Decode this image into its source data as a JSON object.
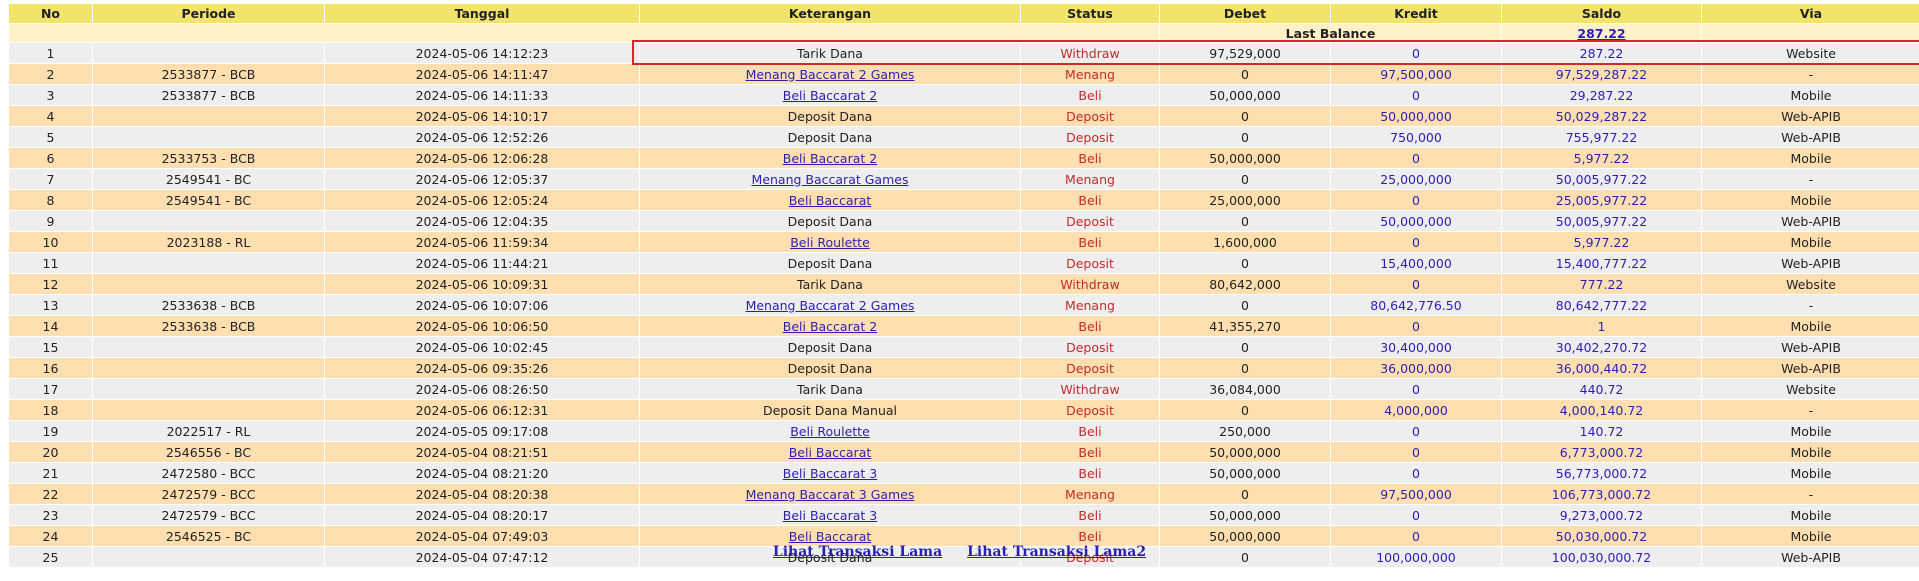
{
  "columns": [
    "No",
    "Periode",
    "Tanggal",
    "Keterangan",
    "Status",
    "Debet",
    "Kredit",
    "Saldo",
    "Via"
  ],
  "last_balance": {
    "label": "Last Balance",
    "value": "287.22"
  },
  "rows": [
    {
      "no": "1",
      "periode": "",
      "tanggal": "2024-05-06 14:12:23",
      "keterangan": "Tarik Dana",
      "link": false,
      "status": "Withdraw",
      "debet": "97,529,000",
      "kredit": "0",
      "saldo": "287.22",
      "via": "Website"
    },
    {
      "no": "2",
      "periode": "2533877 - BCB",
      "tanggal": "2024-05-06 14:11:47",
      "keterangan": "Menang Baccarat 2 Games",
      "link": true,
      "status": "Menang",
      "debet": "0",
      "kredit": "97,500,000",
      "saldo": "97,529,287.22",
      "via": "-"
    },
    {
      "no": "3",
      "periode": "2533877 - BCB",
      "tanggal": "2024-05-06 14:11:33",
      "keterangan": "Beli Baccarat 2",
      "link": true,
      "status": "Beli",
      "debet": "50,000,000",
      "kredit": "0",
      "saldo": "29,287.22",
      "via": "Mobile"
    },
    {
      "no": "4",
      "periode": "",
      "tanggal": "2024-05-06 14:10:17",
      "keterangan": "Deposit Dana",
      "link": false,
      "status": "Deposit",
      "debet": "0",
      "kredit": "50,000,000",
      "saldo": "50,029,287.22",
      "via": "Web-APIB"
    },
    {
      "no": "5",
      "periode": "",
      "tanggal": "2024-05-06 12:52:26",
      "keterangan": "Deposit Dana",
      "link": false,
      "status": "Deposit",
      "debet": "0",
      "kredit": "750,000",
      "saldo": "755,977.22",
      "via": "Web-APIB"
    },
    {
      "no": "6",
      "periode": "2533753 - BCB",
      "tanggal": "2024-05-06 12:06:28",
      "keterangan": "Beli Baccarat 2",
      "link": true,
      "status": "Beli",
      "debet": "50,000,000",
      "kredit": "0",
      "saldo": "5,977.22",
      "via": "Mobile"
    },
    {
      "no": "7",
      "periode": "2549541 - BC",
      "tanggal": "2024-05-06 12:05:37",
      "keterangan": "Menang Baccarat Games",
      "link": true,
      "status": "Menang",
      "debet": "0",
      "kredit": "25,000,000",
      "saldo": "50,005,977.22",
      "via": "-"
    },
    {
      "no": "8",
      "periode": "2549541 - BC",
      "tanggal": "2024-05-06 12:05:24",
      "keterangan": "Beli Baccarat",
      "link": true,
      "status": "Beli",
      "debet": "25,000,000",
      "kredit": "0",
      "saldo": "25,005,977.22",
      "via": "Mobile"
    },
    {
      "no": "9",
      "periode": "",
      "tanggal": "2024-05-06 12:04:35",
      "keterangan": "Deposit Dana",
      "link": false,
      "status": "Deposit",
      "debet": "0",
      "kredit": "50,000,000",
      "saldo": "50,005,977.22",
      "via": "Web-APIB"
    },
    {
      "no": "10",
      "periode": "2023188 - RL",
      "tanggal": "2024-05-06 11:59:34",
      "keterangan": "Beli Roulette",
      "link": true,
      "status": "Beli",
      "debet": "1,600,000",
      "kredit": "0",
      "saldo": "5,977.22",
      "via": "Mobile"
    },
    {
      "no": "11",
      "periode": "",
      "tanggal": "2024-05-06 11:44:21",
      "keterangan": "Deposit Dana",
      "link": false,
      "status": "Deposit",
      "debet": "0",
      "kredit": "15,400,000",
      "saldo": "15,400,777.22",
      "via": "Web-APIB"
    },
    {
      "no": "12",
      "periode": "",
      "tanggal": "2024-05-06 10:09:31",
      "keterangan": "Tarik Dana",
      "link": false,
      "status": "Withdraw",
      "debet": "80,642,000",
      "kredit": "0",
      "saldo": "777.22",
      "via": "Website"
    },
    {
      "no": "13",
      "periode": "2533638 - BCB",
      "tanggal": "2024-05-06 10:07:06",
      "keterangan": "Menang Baccarat 2 Games",
      "link": true,
      "status": "Menang",
      "debet": "0",
      "kredit": "80,642,776.50",
      "saldo": "80,642,777.22",
      "via": "-"
    },
    {
      "no": "14",
      "periode": "2533638 - BCB",
      "tanggal": "2024-05-06 10:06:50",
      "keterangan": "Beli Baccarat 2",
      "link": true,
      "status": "Beli",
      "debet": "41,355,270",
      "kredit": "0",
      "saldo": "1",
      "via": "Mobile"
    },
    {
      "no": "15",
      "periode": "",
      "tanggal": "2024-05-06 10:02:45",
      "keterangan": "Deposit Dana",
      "link": false,
      "status": "Deposit",
      "debet": "0",
      "kredit": "30,400,000",
      "saldo": "30,402,270.72",
      "via": "Web-APIB"
    },
    {
      "no": "16",
      "periode": "",
      "tanggal": "2024-05-06 09:35:26",
      "keterangan": "Deposit Dana",
      "link": false,
      "status": "Deposit",
      "debet": "0",
      "kredit": "36,000,000",
      "saldo": "36,000,440.72",
      "via": "Web-APIB"
    },
    {
      "no": "17",
      "periode": "",
      "tanggal": "2024-05-06 08:26:50",
      "keterangan": "Tarik Dana",
      "link": false,
      "status": "Withdraw",
      "debet": "36,084,000",
      "kredit": "0",
      "saldo": "440.72",
      "via": "Website"
    },
    {
      "no": "18",
      "periode": "",
      "tanggal": "2024-05-06 06:12:31",
      "keterangan": "Deposit Dana Manual",
      "link": false,
      "status": "Deposit",
      "debet": "0",
      "kredit": "4,000,000",
      "saldo": "4,000,140.72",
      "via": "-"
    },
    {
      "no": "19",
      "periode": "2022517 - RL",
      "tanggal": "2024-05-05 09:17:08",
      "keterangan": "Beli Roulette",
      "link": true,
      "status": "Beli",
      "debet": "250,000",
      "kredit": "0",
      "saldo": "140.72",
      "via": "Mobile"
    },
    {
      "no": "20",
      "periode": "2546556 - BC",
      "tanggal": "2024-05-04 08:21:51",
      "keterangan": "Beli Baccarat",
      "link": true,
      "status": "Beli",
      "debet": "50,000,000",
      "kredit": "0",
      "saldo": "6,773,000.72",
      "via": "Mobile"
    },
    {
      "no": "21",
      "periode": "2472580 - BCC",
      "tanggal": "2024-05-04 08:21:20",
      "keterangan": "Beli Baccarat 3",
      "link": true,
      "status": "Beli",
      "debet": "50,000,000",
      "kredit": "0",
      "saldo": "56,773,000.72",
      "via": "Mobile"
    },
    {
      "no": "22",
      "periode": "2472579 - BCC",
      "tanggal": "2024-05-04 08:20:38",
      "keterangan": "Menang Baccarat 3 Games",
      "link": true,
      "status": "Menang",
      "debet": "0",
      "kredit": "97,500,000",
      "saldo": "106,773,000.72",
      "via": "-"
    },
    {
      "no": "23",
      "periode": "2472579 - BCC",
      "tanggal": "2024-05-04 08:20:17",
      "keterangan": "Beli Baccarat 3",
      "link": true,
      "status": "Beli",
      "debet": "50,000,000",
      "kredit": "0",
      "saldo": "9,273,000.72",
      "via": "Mobile"
    },
    {
      "no": "24",
      "periode": "2546525 - BC",
      "tanggal": "2024-05-04 07:49:03",
      "keterangan": "Beli Baccarat",
      "link": true,
      "status": "Beli",
      "debet": "50,000,000",
      "kredit": "0",
      "saldo": "50,030,000.72",
      "via": "Mobile"
    },
    {
      "no": "25",
      "periode": "",
      "tanggal": "2024-05-04 07:47:12",
      "keterangan": "Deposit Dana",
      "link": false,
      "status": "Deposit",
      "debet": "0",
      "kredit": "100,000,000",
      "saldo": "100,030,000.72",
      "via": "Web-APIB"
    }
  ],
  "footer": {
    "link1": "Lihat Transaksi Lama",
    "link2": "Lihat Transaksi Lama2"
  },
  "colors": {
    "header_bg": "#f2e46a",
    "row_odd": "#eeeeee",
    "row_even": "#ffdfb0",
    "credit_text": "#2b1fb3",
    "status_text": "#c42b2b",
    "highlight_border": "#d12a2a"
  }
}
